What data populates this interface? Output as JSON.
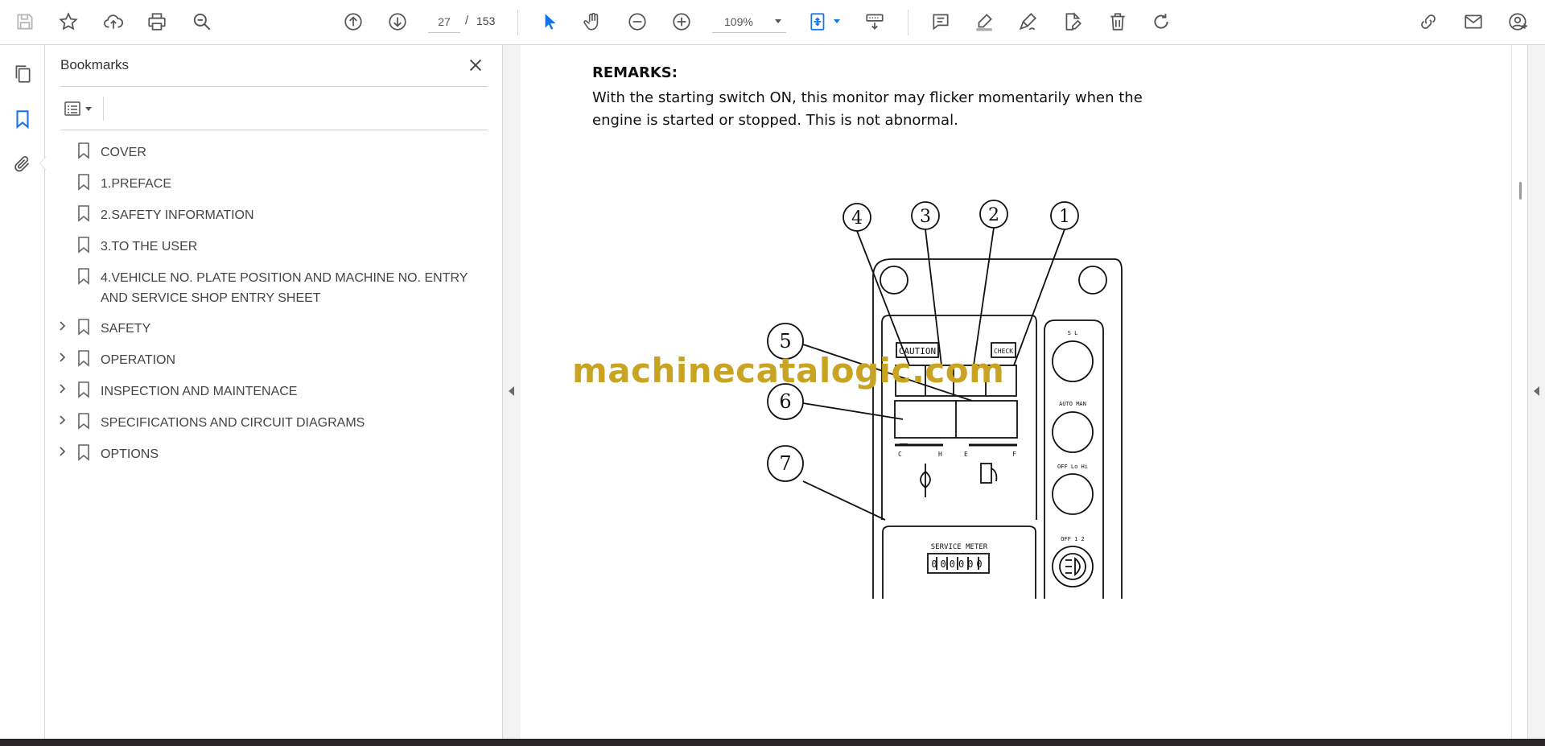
{
  "toolbar": {
    "page_current": "27",
    "page_separator": "/",
    "page_total": "153",
    "zoom": "109%",
    "accent_color": "#1473e6",
    "icons": [
      "save-icon",
      "star-icon",
      "cloud-upload-icon",
      "print-icon",
      "search-icon",
      "page-up-icon",
      "page-down-icon",
      "select-cursor-icon",
      "hand-icon",
      "zoom-out-icon",
      "zoom-in-icon",
      "fit-page-icon",
      "scroll-mode-icon",
      "comment-icon",
      "highlight-icon",
      "sign-icon",
      "edit-pdf-icon",
      "delete-icon",
      "rotate-icon",
      "share-link-icon",
      "email-icon",
      "add-user-icon"
    ]
  },
  "panel": {
    "title": "Bookmarks",
    "bookmarks": [
      {
        "label": "COVER",
        "expandable": false
      },
      {
        "label": "1.PREFACE",
        "expandable": false
      },
      {
        "label": "2.SAFETY INFORMATION",
        "expandable": false
      },
      {
        "label": "3.TO THE USER",
        "expandable": false
      },
      {
        "label": "4.VEHICLE NO. PLATE POSITION AND MACHINE NO. ENTRY AND SERVICE SHOP ENTRY SHEET",
        "expandable": false
      },
      {
        "label": "SAFETY",
        "expandable": true
      },
      {
        "label": "OPERATION",
        "expandable": true
      },
      {
        "label": "INSPECTION AND MAINTENACE",
        "expandable": true
      },
      {
        "label": "SPECIFICATIONS AND CIRCUIT DIAGRAMS",
        "expandable": true
      },
      {
        "label": "OPTIONS",
        "expandable": true
      }
    ]
  },
  "document": {
    "remarks_heading": "REMARKS:",
    "remarks_text": "With the starting switch ON, this monitor may flicker momentarily when the engine is started or stopped.  This is not abnormal.",
    "watermark": "machinecatalogic.com",
    "diagram": {
      "callouts": [
        "4",
        "3",
        "2",
        "1",
        "5",
        "6",
        "7"
      ],
      "caution_label": "CAUTION",
      "check_label": "CHECK",
      "service_meter_label": "SERVICE METER",
      "meter_digits": "000000",
      "gauge_left_ends": [
        "C",
        "H"
      ],
      "gauge_right_ends": [
        "E",
        "F"
      ],
      "knob_labels": [
        "S L",
        "AUTO MAN",
        "OFF Lo Hi",
        "OFF 1 2"
      ]
    }
  }
}
